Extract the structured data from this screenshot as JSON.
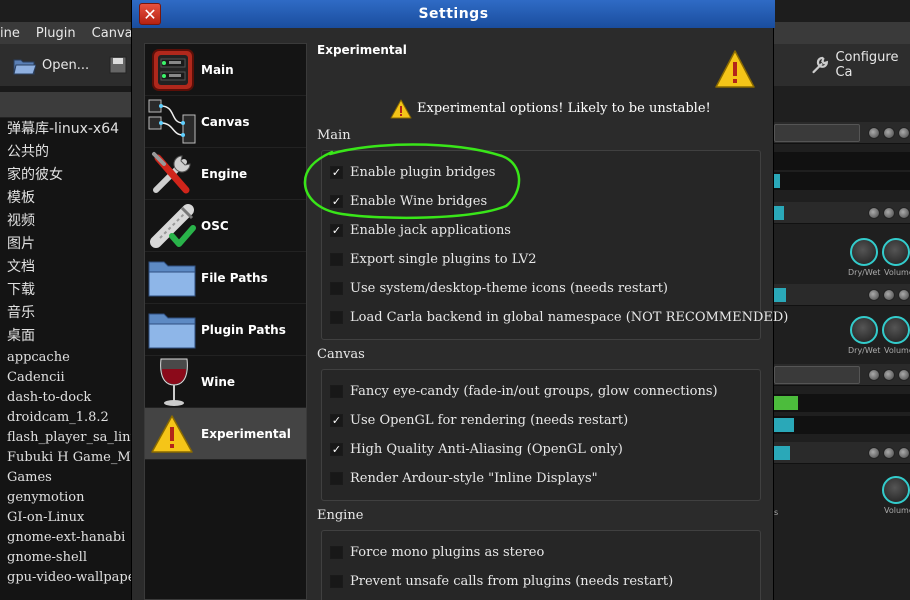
{
  "background_app": {
    "menu": [
      "ine",
      "Plugin",
      "Canvas"
    ],
    "toolbar": {
      "open_label": "Open...",
      "configure_label": "Configure Ca",
      "partial_c": "c"
    },
    "file_tree": [
      "弹幕库-linux-x64",
      "公共的",
      "家的彼女",
      "模板",
      "视频",
      "图片",
      "文档",
      "下载",
      "音乐",
      "桌面",
      "appcache",
      "Cadencii",
      "dash-to-dock",
      "droidcam_1.8.2",
      "flash_player_sa_linux",
      "Fubuki H Game_M",
      "Games",
      "genymotion",
      "GI-on-Linux",
      "gnome-ext-hanabi",
      "gnome-shell",
      "gpu-video-wallpaper"
    ],
    "rack": {
      "knob_labels": [
        "Dry/Wet",
        "Volume"
      ],
      "partial_label": "s"
    }
  },
  "dialog": {
    "title": "Settings",
    "close_glyph": "✕",
    "sidebar": [
      {
        "label": "Main",
        "icon": "carla-main-icon"
      },
      {
        "label": "Canvas",
        "icon": "canvas-patchbay-icon"
      },
      {
        "label": "Engine",
        "icon": "engine-tools-icon"
      },
      {
        "label": "OSC",
        "icon": "osc-plug-icon"
      },
      {
        "label": "File Paths",
        "icon": "folder-icon"
      },
      {
        "label": "Plugin Paths",
        "icon": "folder-icon"
      },
      {
        "label": "Wine",
        "icon": "wine-glass-icon"
      },
      {
        "label": "Experimental",
        "icon": "warning-icon",
        "selected": true
      }
    ],
    "content": {
      "header": "Experimental",
      "warning_text": "Experimental options! Likely to be unstable!",
      "sections": [
        {
          "title": "Main",
          "options": [
            {
              "label": "Enable plugin bridges",
              "checked": true
            },
            {
              "label": "Enable Wine bridges",
              "checked": true
            },
            {
              "label": "Enable jack applications",
              "checked": true
            },
            {
              "label": "Export single plugins to LV2",
              "checked": false
            },
            {
              "label": "Use system/desktop-theme icons (needs restart)",
              "checked": false
            },
            {
              "label": "Load Carla backend in global namespace (NOT RECOMMENDED)",
              "checked": false
            }
          ]
        },
        {
          "title": "Canvas",
          "options": [
            {
              "label": "Fancy eye-candy (fade-in/out groups, glow connections)",
              "checked": false
            },
            {
              "label": "Use OpenGL for rendering (needs restart)",
              "checked": true
            },
            {
              "label": "High Quality Anti-Aliasing (OpenGL only)",
              "checked": true
            },
            {
              "label": "Render Ardour-style \"Inline Displays\"",
              "checked": false
            }
          ]
        },
        {
          "title": "Engine",
          "options": [
            {
              "label": "Force mono plugins as stereo",
              "checked": false
            },
            {
              "label": "Prevent unsafe calls from plugins (needs restart)",
              "checked": false
            }
          ]
        }
      ]
    },
    "check_glyph": "✓"
  },
  "colors": {
    "titlebar": "#1f58b0",
    "highlight_stroke": "#39e619",
    "warning_yellow": "#f5c518",
    "selected_nav": "#444444"
  }
}
